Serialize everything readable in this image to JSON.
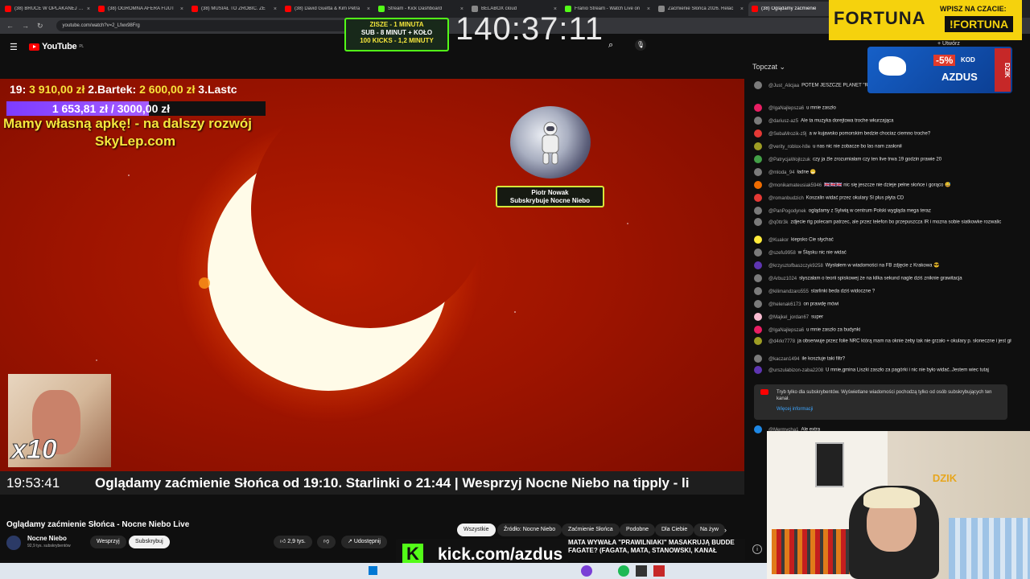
{
  "browser": {
    "tabs": [
      {
        "label": "(38) BRUCE W OPLAKANEJ SYT",
        "color": "#ff0000",
        "active": false
      },
      {
        "label": "(38) OGROMNA AFERA FIJUT",
        "color": "#ff0000",
        "active": false
      },
      {
        "label": "(38) MUSIAŁ TO ZROBIĆ. ZE",
        "color": "#ff0000",
        "active": false
      },
      {
        "label": "(38) David Guetta & Kim Petra",
        "color": "#ff0000",
        "active": false
      },
      {
        "label": "Stream - Kick Dashboard",
        "color": "#53fc18",
        "active": false
      },
      {
        "label": "BELABOX cloud",
        "color": "#888888",
        "active": false
      },
      {
        "label": "Franio Stream - Watch Live on",
        "color": "#53fc18",
        "active": false
      },
      {
        "label": "Zaćmienie Słońca 2026. Relac",
        "color": "#888888",
        "active": false
      },
      {
        "label": "(38) Oglądamy zaćmienie",
        "color": "#ff0000",
        "active": true
      }
    ],
    "url": "youtube.com/watch?v=2_Lfwx98Frg"
  },
  "youtube": {
    "logo": "YouTube",
    "country": "PL",
    "create_label": "Utwórz"
  },
  "overlay": {
    "donors_prefix": "19:",
    "donor1_amount": "3 910,00 zł",
    "donor2_label": "2.Bartek:",
    "donor2_amount": "2 600,00 zł",
    "donor3_label": "3.Lastc",
    "goal_text": "1 653,81 zł / 3000,00 zł",
    "goal_fraction": 0.551,
    "app_line1": "Mamy własną apkę! - na dalszy rozwój",
    "app_line2": "SkyLep.com",
    "alert_name": "Piotr Nowak",
    "alert_msg": "Subskrybuje Nocne Niebo",
    "x10": "x10",
    "clock": "19:53:41",
    "ticker": "Oglądamy zaćmienie Słońca od 19:10. Starlinki o 21:44 |  Wesprzyj Nocne Niebo na tipply - li"
  },
  "timer": {
    "line1": "ZISZE - 1 MINUTA",
    "line2": "SUB - 8 MINUT + KOŁO",
    "line3": "100 KICKS - 1,2 MINUTY",
    "big": "140:37:11"
  },
  "video_info": {
    "title": "Oglądamy zaćmienie Słońca - Nocne Niebo Live",
    "channel": "Nocne Niebo",
    "subs": "92,9 tys. subskrybentów",
    "support": "Wesprzyj",
    "subscribe": "Subskrybuj",
    "likes": "2,9 tys.",
    "share": "Udostępnij"
  },
  "chips": [
    "Wszystkie",
    "Źródło: Nocne Niebo",
    "Zaćmienie Słońca",
    "Podobne",
    "Dla Ciebie",
    "Na żyw"
  ],
  "chat": {
    "header": "Topczat",
    "messages": [
      {
        "author": "@Just_Alicjaa",
        "text": "POTEM JESZCZE PLANET \"RAKIET\" WYSŁANE DZIŚ RANO Z KALIFORNII O 21:44 BĘDĄ LECIAŁ ZA SŁOŃCE",
        "color": "#7b7b7b"
      },
      {
        "author": "@IgaNajlepsza6",
        "text": "u mnie zaszło",
        "color": "#e91e63"
      },
      {
        "author": "@dariusz-az5",
        "text": "Ale ta muzyka dorejtowa troche wkurzająca",
        "color": "#7b7b7b"
      },
      {
        "author": "@SebaMrozik-z9j",
        "text": "a w kujawsko pomorskim bedzie chociaz ciemno troche?",
        "color": "#e53935"
      },
      {
        "author": "@verity_roblox-h8e",
        "text": "u nas nic nie zobacze bo las nam zasłonił",
        "color": "#9e9d24"
      },
      {
        "author": "@PatrycjaWojtczuk",
        "text": "czy ja źle zrozumiałam czy ten live trwa 19 godzin prawie 20",
        "color": "#43a047"
      },
      {
        "author": "@mlodа_94",
        "text": "ładne 😁",
        "color": "#7b7b7b"
      },
      {
        "author": "@monikamateusiak5946",
        "text": "🇬🇧🇬🇧🇬🇧 nic się jeszcze nie dzieje pełne słońce i gorąco 😅",
        "color": "#ef6c00"
      },
      {
        "author": "@romanbudzich",
        "text": "Koszalin widać przez okulary Sl plus płyta CD",
        "color": "#e53935"
      },
      {
        "author": "@PanPogodynek",
        "text": "oglądamy z Sylwią w centrum Polski wygląda mega teraz",
        "color": "#7b7b7b"
      },
      {
        "author": "@q0ttr3k",
        "text": "zdjecie rtg polecam patrzec, ale przez telefon bo przepuszcza IR i mozna sobie siatkowke rozwalic",
        "color": "#7b7b7b"
      },
      {
        "author": "@Kuakor",
        "text": "kiepsko Cie słychać",
        "color": "#ffeb3b"
      },
      {
        "author": "@szefu9958",
        "text": "w Śląsku nic nie widać",
        "color": "#7b7b7b"
      },
      {
        "author": "@krzysztofbaszczyk9258",
        "text": "Wysłałem w wiadomości na FB zdjęcie z Krakowa 😎",
        "color": "#5e35b1"
      },
      {
        "author": "@Arbuz1024",
        "text": "słyszałam o teorii spiskowej że na kilka sekund nagle dziś zniknie grawitacja",
        "color": "#7b7b7b"
      },
      {
        "author": "@kilimandzaro555",
        "text": "starlinki beda dziś widoczne ?",
        "color": "#7b7b7b"
      },
      {
        "author": "@helenak6173",
        "text": "on prawdę mówi",
        "color": "#7b7b7b"
      },
      {
        "author": "@Majkel_jordan67",
        "text": "super",
        "color": "#f8bbd0"
      },
      {
        "author": "@IgaNajlepsza6",
        "text": "u mnie zaszło za budynki",
        "color": "#e91e63"
      },
      {
        "author": "@d4rkr7778",
        "text": "ja obserwuje przez folie NRC którą mam na oknie żeby tak nie grzało + okulary p. słoneczne i jest git :D",
        "color": "#9e9d24"
      },
      {
        "author": "@kaczan1494",
        "text": "ile kosztuje taki filtr?",
        "color": "#7b7b7b"
      },
      {
        "author": "@urszulabizon-zaba2208",
        "text": "U mnie,gmina Liszki zaszło za pagórki i nic nie było widać..Jestem wiec tutaj",
        "color": "#5e35b1"
      }
    ],
    "subonly": "Tryb tylko dla subskrybentów. Wyświetlane wiadomości pochodzą tylko od osób subskrybujących ten kanał.",
    "more_info": "Więcej informacji",
    "last_author": "@Mermycha1",
    "last_text": "Ale extra"
  },
  "ads": {
    "fortuna": "FORTUNA",
    "fortuna_top": "WPISZ NA CZACIE:",
    "fortuna_code": "!FORTUNA",
    "discount": "-5%",
    "kod": "KOD",
    "azdus": "AZDUS",
    "dzik": "DZIK"
  },
  "kick": {
    "url": "kick.com/azdus",
    "k": "K"
  },
  "news": {
    "line1": "MATA WYWAŁA \"PRAWILNIAKI\" MASAKRUJĄ BUDDE",
    "line2": "FAGATE? (FAGATA, MATA, STANOWSKI, KANAŁ"
  }
}
